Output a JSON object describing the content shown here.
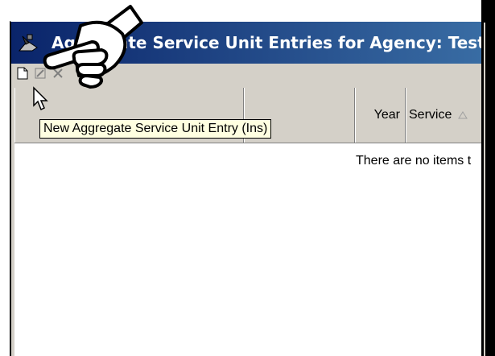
{
  "window": {
    "title": "Aggregate Service Unit Entries for Agency: Test Age"
  },
  "toolbar": {
    "buttons": [
      {
        "icon": "new-document-icon"
      },
      {
        "icon": "edit-icon"
      },
      {
        "icon": "delete-icon"
      }
    ]
  },
  "tooltip": {
    "text": "New Aggregate Service Unit Entry (Ins)"
  },
  "grid": {
    "columns": [
      {
        "label": ""
      },
      {
        "label": ""
      },
      {
        "label": "Year"
      },
      {
        "label": "Service",
        "sort_icon": "sort-ascending-icon"
      }
    ],
    "empty_message": "There are no items t"
  },
  "colors": {
    "title_bar_start": "#0a246a",
    "title_bar_end": "#3a6ea5",
    "window_face": "#d4d0c8",
    "tooltip_bg": "#ffffe1"
  }
}
